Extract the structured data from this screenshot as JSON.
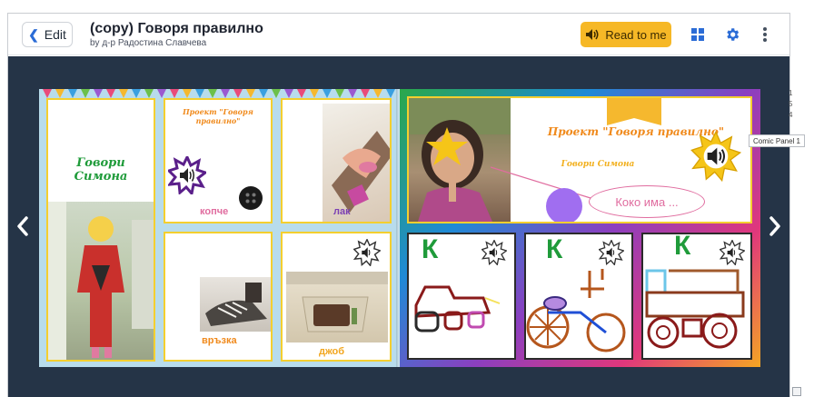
{
  "header": {
    "edit_label": "Edit",
    "title": "(copy) Говоря правилно",
    "byline": "by д-р Радостина Славчева",
    "read_label": "Read to me"
  },
  "icons": {
    "back": "chevron-left-icon",
    "audio": "speaker-icon",
    "grid": "grid-icon",
    "settings": "gear-icon",
    "more": "kebab-icon",
    "prev": "arrow-left-icon",
    "next": "arrow-right-icon"
  },
  "colors": {
    "accent": "#f6b826",
    "brand_blue": "#2b6cd6",
    "stage": "#253447",
    "panel_border": "#f4cf2f"
  },
  "left_page": {
    "panel1_title": "Говори Симона",
    "panel2_title": "Проект \"Говоря правилно\"",
    "panel2_word": "копче",
    "panel3_word": "лак",
    "panel5_word": "връзка",
    "panel6_word": "джоб"
  },
  "right_page": {
    "title": "Проект \"Говоря правилно\"",
    "subtitle": "Говори Симона",
    "bubble": "Коко има ...",
    "panel_letter_1": "К",
    "panel_letter_2": "К",
    "panel_letter_3": "К"
  },
  "tooltip": "Comic Panel 1",
  "side_numbers": [
    "1",
    "5",
    "4"
  ]
}
